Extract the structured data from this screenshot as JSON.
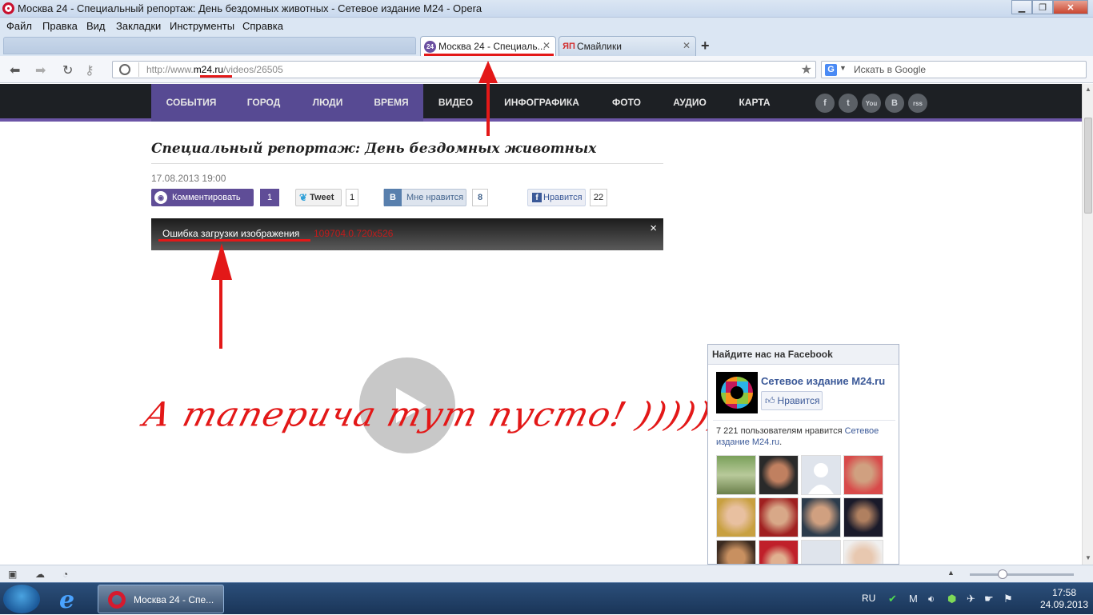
{
  "window": {
    "title": "Москва 24 - Специальный репортаж: День бездомных животных - Сетевое издание М24 - Opera",
    "controls": [
      "minimize",
      "maximize",
      "close"
    ]
  },
  "menu": {
    "items": [
      "Файл",
      "Правка",
      "Вид",
      "Закладки",
      "Инструменты",
      "Справка"
    ]
  },
  "tabs": [
    {
      "icon": "m24-icon",
      "icon_text": "24",
      "label": "Москва 24 - Специаль...",
      "active": true
    },
    {
      "icon": "yap-icon",
      "icon_text": "ЯП",
      "label": "Смайлики",
      "active": false
    }
  ],
  "address": {
    "url_prefix": "http://www.",
    "url_domain": "m24.ru",
    "url_path": "/videos/26505"
  },
  "search": {
    "engine_icon": "G",
    "placeholder": "Искать в Google"
  },
  "site_nav": {
    "items": [
      "СОБЫТИЯ",
      "ГОРОД",
      "ЛЮДИ",
      "ВРЕМЯ",
      "ВИДЕО",
      "ИНФОГРАФИКА",
      "ФОТО",
      "АУДИО",
      "КАРТА"
    ],
    "social": [
      "f",
      "t",
      "You",
      "B",
      "rss"
    ]
  },
  "article": {
    "title": "Специальный репортаж: День бездомных животных",
    "date": "17.08.2013 19:00",
    "comment_label": "Комментировать",
    "comment_count": "1",
    "tweet_label": "Tweet",
    "tweet_count": "1",
    "vk_icon": "B",
    "vk_label": "Мне нравится",
    "vk_count": "8",
    "fb_label": "Нравится",
    "fb_count": "22",
    "error_text": "Ошибка загрузки изображения",
    "error_code": "109704.0.720x526",
    "error_close": "×"
  },
  "annotation": {
    "text": "А таперича тут пусто! ))))))"
  },
  "facebook_widget": {
    "header": "Найдите нас на Facebook",
    "page_name": "Сетевое издание М24.ru",
    "like_label": "Нравится",
    "count_text": "7 221 пользователям нравится ",
    "count_link": "Сетевое издание М24.ru",
    "count_suffix": "."
  },
  "taskbar": {
    "task_label": "Москва 24 - Спе...",
    "lang": "RU",
    "time": "17:58",
    "date": "24.09.2013"
  },
  "colors": {
    "nav_bg": "#1d2024",
    "nav_highlight": "#574a93",
    "accent_purple": "#6b55a6",
    "annotation_red": "#e31818",
    "error_code_red": "#c21b1b",
    "fb_blue": "#3b5998"
  }
}
